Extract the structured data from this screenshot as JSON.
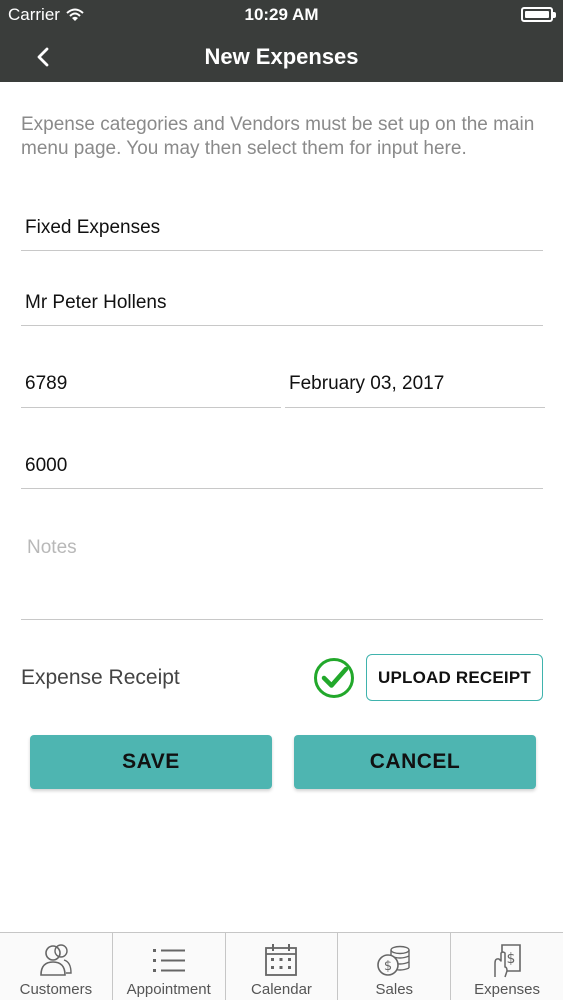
{
  "status_bar": {
    "carrier": "Carrier",
    "time": "10:29 AM"
  },
  "nav": {
    "title": "New Expenses"
  },
  "form": {
    "intro": "Expense categories and Vendors must be set up on the main menu page.  You may then select them for input here.",
    "category": "Fixed Expenses",
    "vendor": "Mr Peter Hollens",
    "reference": "6789",
    "date": "February 03, 2017",
    "amount": "6000",
    "notes_placeholder": "Notes",
    "receipt_label": "Expense Receipt",
    "receipt_attached": true,
    "upload_label": "UPLOAD RECEIPT"
  },
  "actions": {
    "save": "SAVE",
    "cancel": "CANCEL"
  },
  "tabs": [
    {
      "label": "Customers",
      "icon": "customers-icon"
    },
    {
      "label": "Appointment",
      "icon": "list-icon"
    },
    {
      "label": "Calendar",
      "icon": "calendar-icon"
    },
    {
      "label": "Sales",
      "icon": "coins-icon"
    },
    {
      "label": "Expenses",
      "icon": "receipt-hand-icon"
    }
  ],
  "colors": {
    "header": "#3a3d3b",
    "accent": "#4eb5b1",
    "check": "#22a82b"
  }
}
